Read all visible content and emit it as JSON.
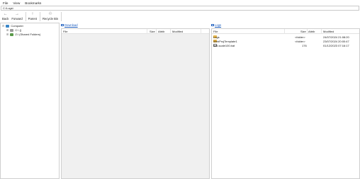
{
  "menu": {
    "file": "File",
    "view": "View",
    "bookmarks": "Bookmarks"
  },
  "path": {
    "value": "C:\\Logs\\"
  },
  "toolbar": {
    "back": "Back",
    "forward": "Forward",
    "parent": "Parent",
    "recycle_bin": "Recycle Bin"
  },
  "tree": {
    "computer": "Computer",
    "drive_c": "C:\\ ()",
    "drive_z": "Z:\\ (Shared Folders)"
  },
  "left_pane": {
    "header": "Download",
    "columns": {
      "file": "File",
      "size": "Size",
      "attrib": "Attrib",
      "modified": "Modified"
    }
  },
  "right_pane": {
    "header": "Logs",
    "columns": {
      "file": "File",
      "size": "Size",
      "attrib": "Attrib",
      "modified": "Modified"
    },
    "rows": [
      {
        "name": "Logs",
        "size": "<folder>",
        "attrib": "",
        "modified": "24/07/2024 21:08:20",
        "icon": "folder-icon"
      },
      {
        "name": "WebProjTemplate1",
        "size": "<folder>",
        "attrib": "",
        "modified": "23/07/2024 20:00:47",
        "icon": "folder-icon"
      },
      {
        "name": "dell-scale100.bat",
        "size": "176",
        "attrib": "",
        "modified": "01/12/2023 07:16:17",
        "icon": "bat-file-icon"
      }
    ]
  },
  "colors": {
    "folder": "#e7b64a",
    "link": "#1f5fbf",
    "computer": "#3a86c8",
    "drive": "#5a9a4a"
  }
}
